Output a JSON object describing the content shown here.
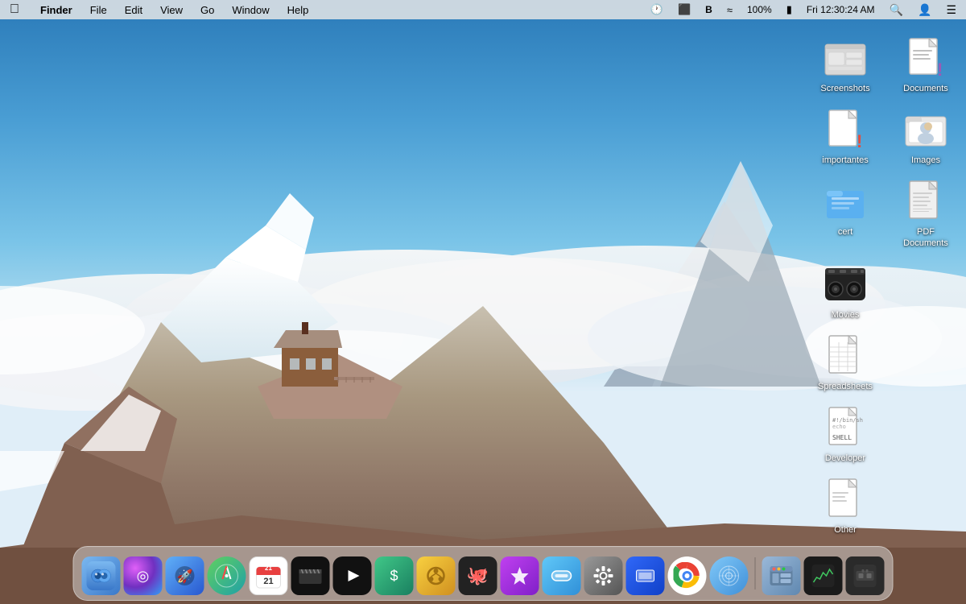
{
  "menubar": {
    "apple_label": "",
    "app_name": "Finder",
    "menus": [
      "File",
      "Edit",
      "View",
      "Go",
      "Window",
      "Help"
    ],
    "right_items": {
      "time_machine": "⏰",
      "airplay": "📺",
      "bluetooth": "🅱",
      "wifi": "📶",
      "battery": "100%",
      "battery_icon": "🔋",
      "datetime": "Fri 12:30:24 AM",
      "search": "🔍",
      "user": "👤",
      "control_center": "☰"
    }
  },
  "desktop_icons": [
    {
      "row": 1,
      "items": [
        {
          "id": "screenshots",
          "label": "Screenshots",
          "type": "folder-screenshots"
        },
        {
          "id": "documents",
          "label": "Documents",
          "type": "doc-exclamation"
        }
      ]
    },
    {
      "row": 2,
      "items": [
        {
          "id": "importantes",
          "label": "importantes",
          "type": "doc-exclamation-red"
        },
        {
          "id": "images",
          "label": "Images",
          "type": "folder-images"
        }
      ]
    },
    {
      "row": 3,
      "items": [
        {
          "id": "cert",
          "label": "cert",
          "type": "folder-blue"
        },
        {
          "id": "pdf-documents",
          "label": "PDF Documents",
          "type": "doc-pdf"
        }
      ]
    },
    {
      "row": 4,
      "items": [
        {
          "id": "movies",
          "label": "Movies",
          "type": "movies"
        },
        {
          "id": "empty",
          "label": "",
          "type": "empty"
        }
      ]
    },
    {
      "row": 5,
      "items": [
        {
          "id": "spreadsheets",
          "label": "Spreadsheets",
          "type": "spreadsheets"
        },
        {
          "id": "empty2",
          "label": "",
          "type": "empty"
        }
      ]
    },
    {
      "row": 6,
      "items": [
        {
          "id": "developer",
          "label": "Developer",
          "type": "developer"
        },
        {
          "id": "empty3",
          "label": "",
          "type": "empty"
        }
      ]
    },
    {
      "row": 7,
      "items": [
        {
          "id": "other",
          "label": "Other",
          "type": "other"
        },
        {
          "id": "empty4",
          "label": "",
          "type": "empty"
        }
      ]
    }
  ],
  "dock": {
    "items": [
      {
        "id": "finder",
        "label": "Finder",
        "class": "dock-finder"
      },
      {
        "id": "siri",
        "label": "Siri",
        "class": "dock-siri"
      },
      {
        "id": "launchpad",
        "label": "Launchpad",
        "class": "dock-launchpad"
      },
      {
        "id": "safari",
        "label": "Safari",
        "class": "dock-safari"
      },
      {
        "id": "calendar",
        "label": "Calendar",
        "class": "dock-calendar"
      },
      {
        "id": "claquette",
        "label": "Claquette",
        "class": "dock-claquette"
      },
      {
        "id": "iina",
        "label": "IINA",
        "class": "dock-iina"
      },
      {
        "id": "cashculator",
        "label": "Cashculator",
        "class": "dock-cashculator"
      },
      {
        "id": "gitup",
        "label": "GitUp",
        "class": "dock-gitup"
      },
      {
        "id": "github",
        "label": "GitHub Desktop",
        "class": "dock-github"
      },
      {
        "id": "astro",
        "label": "Astro",
        "class": "dock-astro"
      },
      {
        "id": "pock",
        "label": "Pock",
        "class": "dock-pock"
      },
      {
        "id": "system-prefs",
        "label": "System Preferences",
        "class": "dock-system"
      },
      {
        "id": "deckset",
        "label": "Deckset",
        "class": "dock-deckset"
      },
      {
        "id": "chrome",
        "label": "Chrome",
        "class": "dock-chrome"
      },
      {
        "id": "network",
        "label": "Network Radar",
        "class": "dock-network"
      },
      {
        "id": "finder2",
        "label": "Finder Window",
        "class": "dock-finder2"
      },
      {
        "id": "monitor",
        "label": "Activity Monitor",
        "class": "dock-monitor"
      },
      {
        "id": "monitor2",
        "label": "GPU Monitor",
        "class": "dock-monitor2"
      }
    ]
  }
}
